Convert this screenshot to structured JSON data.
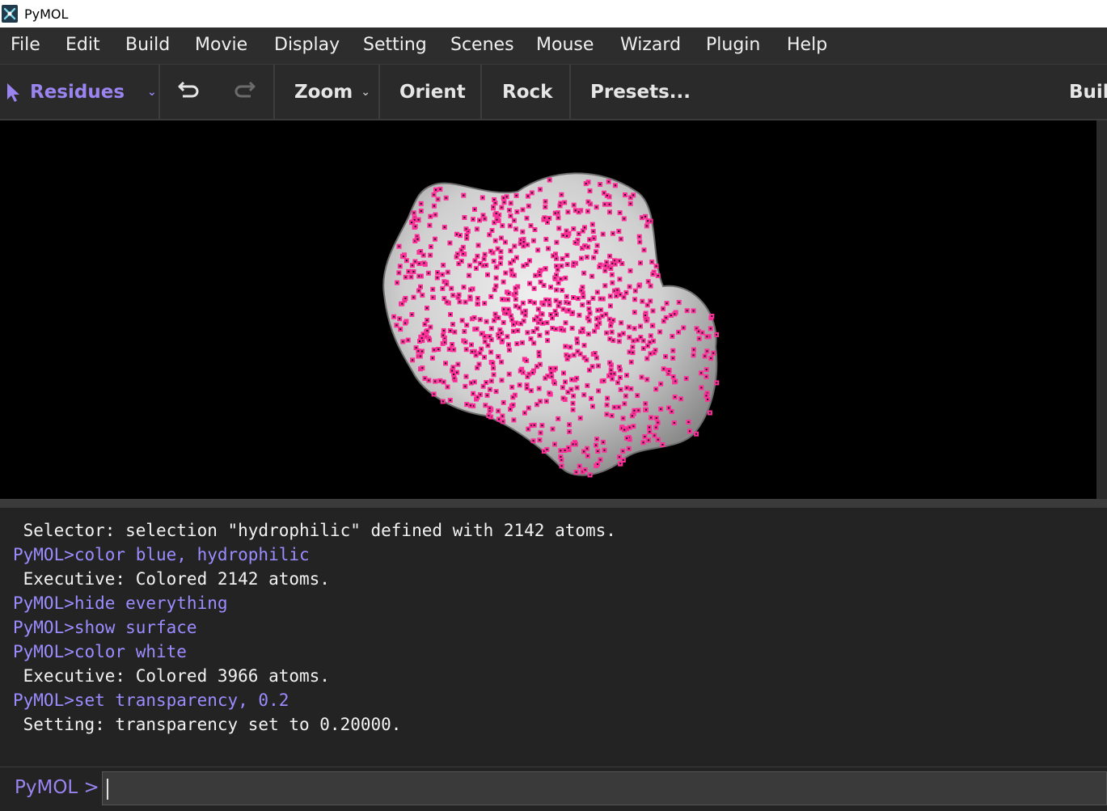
{
  "window": {
    "title": "PyMOL"
  },
  "menu": [
    "File",
    "Edit",
    "Build",
    "Movie",
    "Display",
    "Setting",
    "Scenes",
    "Mouse",
    "Wizard",
    "Plugin",
    "Help"
  ],
  "toolbar": {
    "selection_mode": "Residues",
    "zoom": "Zoom",
    "orient": "Orient",
    "rock": "Rock",
    "presets": "Presets...",
    "builder": "Buil"
  },
  "viewport": {
    "surface_color": "#d9d9d9",
    "dot_color": "#ff2f9a",
    "background": "#000000"
  },
  "console": {
    "lines": [
      {
        "type": "out",
        "text": " Selector: selection \"hydrophilic\" defined with 2142 atoms."
      },
      {
        "type": "cmd",
        "text": "PyMOL>color blue, hydrophilic"
      },
      {
        "type": "out",
        "text": " Executive: Colored 2142 atoms."
      },
      {
        "type": "cmd",
        "text": "PyMOL>hide everything"
      },
      {
        "type": "cmd",
        "text": "PyMOL>show surface"
      },
      {
        "type": "cmd",
        "text": "PyMOL>color white"
      },
      {
        "type": "out",
        "text": " Executive: Colored 3966 atoms."
      },
      {
        "type": "cmd",
        "text": "PyMOL>set transparency, 0.2"
      },
      {
        "type": "out",
        "text": " Setting: transparency set to 0.20000."
      }
    ]
  },
  "prompt": {
    "label": "PyMOL >",
    "value": ""
  }
}
